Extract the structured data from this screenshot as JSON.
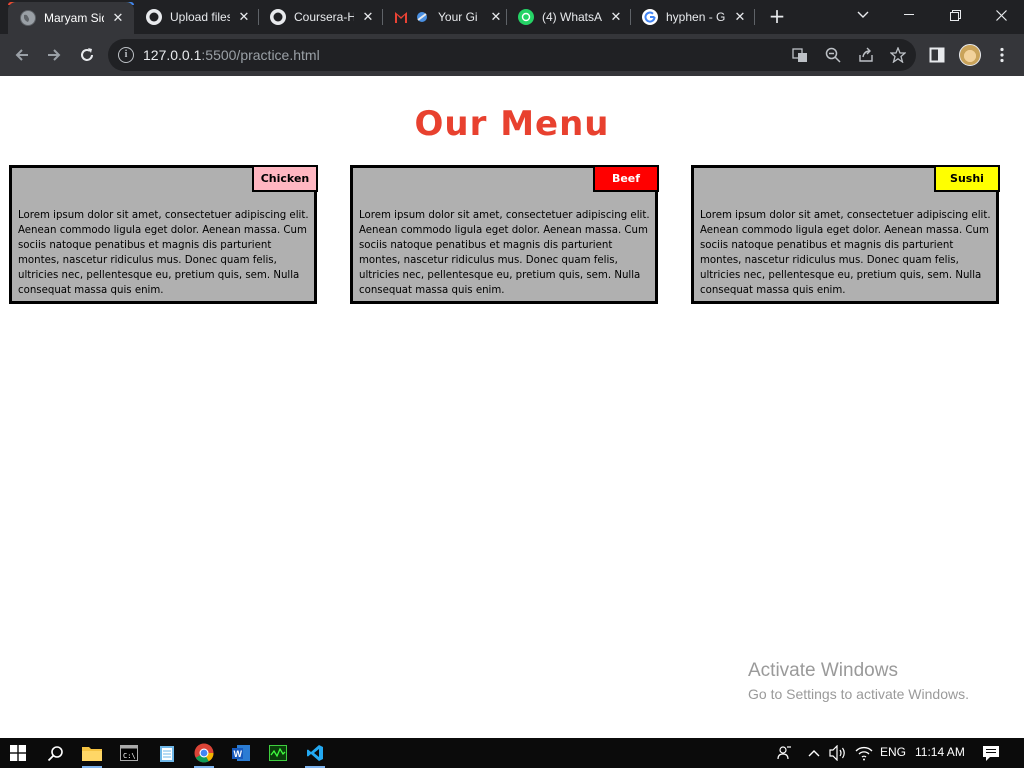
{
  "browser": {
    "tabs": [
      {
        "title": "Maryam Sid",
        "icon": "globe-icon",
        "active": true
      },
      {
        "title": "Upload files",
        "icon": "github-icon",
        "active": false
      },
      {
        "title": "Coursera-H",
        "icon": "github-icon",
        "active": false
      },
      {
        "title": "Your Gi",
        "icon": "gmail-icon",
        "active": false
      },
      {
        "title": "(4) WhatsA",
        "icon": "whatsapp-icon",
        "active": false
      },
      {
        "title": "hyphen - G",
        "icon": "google-icon",
        "active": false
      }
    ],
    "url_host": "127.0.0.1",
    "url_rest": ":5500/practice.html"
  },
  "page": {
    "title": "Our Menu",
    "cards": [
      {
        "label": "Chicken",
        "color": "#ffb6c1",
        "label_color": "#000000",
        "text": "Lorem ipsum dolor sit amet, consectetuer adipiscing elit. Aenean commodo ligula eget dolor. Aenean massa. Cum sociis natoque penatibus et magnis dis parturient montes, nascetur ridiculus mus. Donec quam felis, ultricies nec, pellentesque eu, pretium quis, sem. Nulla consequat massa quis enim."
      },
      {
        "label": "Beef",
        "color": "#ff0000",
        "label_color": "#ffffff",
        "text": "Lorem ipsum dolor sit amet, consectetuer adipiscing elit. Aenean commodo ligula eget dolor. Aenean massa. Cum sociis natoque penatibus et magnis dis parturient montes, nascetur ridiculus mus. Donec quam felis, ultricies nec, pellentesque eu, pretium quis, sem. Nulla consequat massa quis enim."
      },
      {
        "label": "Sushi",
        "color": "#ffff00",
        "label_color": "#000000",
        "text": "Lorem ipsum dolor sit amet, consectetuer adipiscing elit. Aenean commodo ligula eget dolor. Aenean massa. Cum sociis natoque penatibus et magnis dis parturient montes, nascetur ridiculus mus. Donec quam felis, ultricies nec, pellentesque eu, pretium quis, sem. Nulla consequat massa quis enim."
      }
    ]
  },
  "watermark": {
    "line1": "Activate Windows",
    "line2": "Go to Settings to activate Windows."
  },
  "taskbar": {
    "language": "ENG",
    "time": "11:14 AM"
  },
  "colors": {
    "title": "#e8412f",
    "card_bg": "#b0b0b0"
  }
}
